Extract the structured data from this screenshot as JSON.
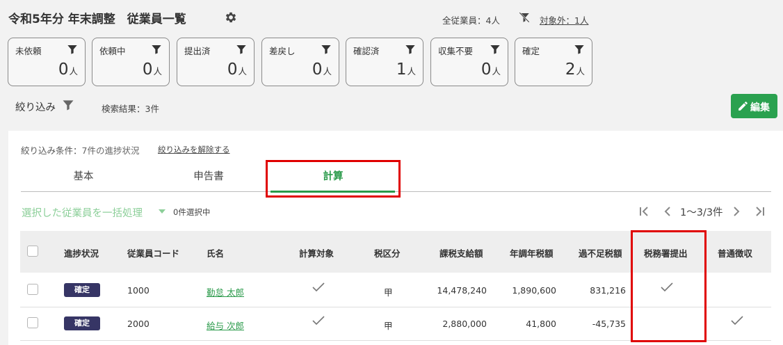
{
  "header": {
    "title": "令和5年分 年末調整　従業員一覧",
    "total": "全従業員：4人",
    "excluded": "対象外：1人"
  },
  "status_cards": [
    {
      "label": "未依頼",
      "count": "0",
      "unit": "人"
    },
    {
      "label": "依頼中",
      "count": "0",
      "unit": "人"
    },
    {
      "label": "提出済",
      "count": "0",
      "unit": "人"
    },
    {
      "label": "差戻し",
      "count": "0",
      "unit": "人"
    },
    {
      "label": "確認済",
      "count": "1",
      "unit": "人"
    },
    {
      "label": "収集不要",
      "count": "0",
      "unit": "人"
    },
    {
      "label": "確定",
      "count": "2",
      "unit": "人"
    }
  ],
  "filter": {
    "label": "絞り込み",
    "result": "検索結果：3件"
  },
  "toolbar": {
    "edit_label": "編集"
  },
  "conditions": {
    "label": "絞り込み条件：",
    "value": "7件の進捗状況",
    "clear": "絞り込みを解除する"
  },
  "tabs": [
    {
      "label": "基本"
    },
    {
      "label": "申告書"
    },
    {
      "label": "計算"
    }
  ],
  "bulk": {
    "label": "選択した従業員を一括処理",
    "selected": "0件選択中"
  },
  "pager": {
    "range": "1〜3/3件"
  },
  "table": {
    "columns": [
      "進捗状況",
      "従業員コード",
      "氏名",
      "計算対象",
      "税区分",
      "課税支給額",
      "年調年税額",
      "過不足税額",
      "税務署提出",
      "普通徴収"
    ],
    "rows": [
      {
        "status": "確定",
        "code": "1000",
        "name": "勤怠 太郎",
        "calc": true,
        "tax_class": "甲",
        "taxable": "14,478,240",
        "annual_tax": "1,890,600",
        "diff": "831,216",
        "tax_office": true,
        "ordinary": false
      },
      {
        "status": "確定",
        "code": "2000",
        "name": "給与 次郎",
        "calc": true,
        "tax_class": "甲",
        "taxable": "2,880,000",
        "annual_tax": "41,800",
        "diff": "-45,735",
        "tax_office": false,
        "ordinary": true
      }
    ]
  },
  "colors": {
    "accent": "#2aa14f",
    "badge": "#363565",
    "highlight": "#e00000"
  }
}
